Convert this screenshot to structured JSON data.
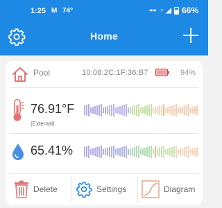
{
  "status_bar": {
    "time": "1:25",
    "mail_glyph": "M",
    "temperature": "74°",
    "link_glyph": "⊶",
    "wifi_glyph": "◔",
    "signal_glyph": "◢",
    "battery": "66%",
    "battery_level": 0.66
  },
  "header": {
    "title": "Home",
    "settings_icon": "gear-icon",
    "add_icon": "plus-icon"
  },
  "device": {
    "name": "Pool",
    "mac": "10:08:2C:1F:36:B7",
    "battery_percent": "94%",
    "battery_icon_color": "#e53935"
  },
  "readings": {
    "temperature": {
      "value": "76.91°F",
      "sub": "(External)"
    },
    "humidity": {
      "value": "65.41%"
    }
  },
  "actions": {
    "delete": "Delete",
    "settings": "Settings",
    "diagram": "Diagram"
  },
  "colors": {
    "app_bar": "#1e88e5",
    "accent": "#1e88e5",
    "delete": "#e57373",
    "temp_icon": "#e57373",
    "hum_icon": "#1e88e5"
  }
}
